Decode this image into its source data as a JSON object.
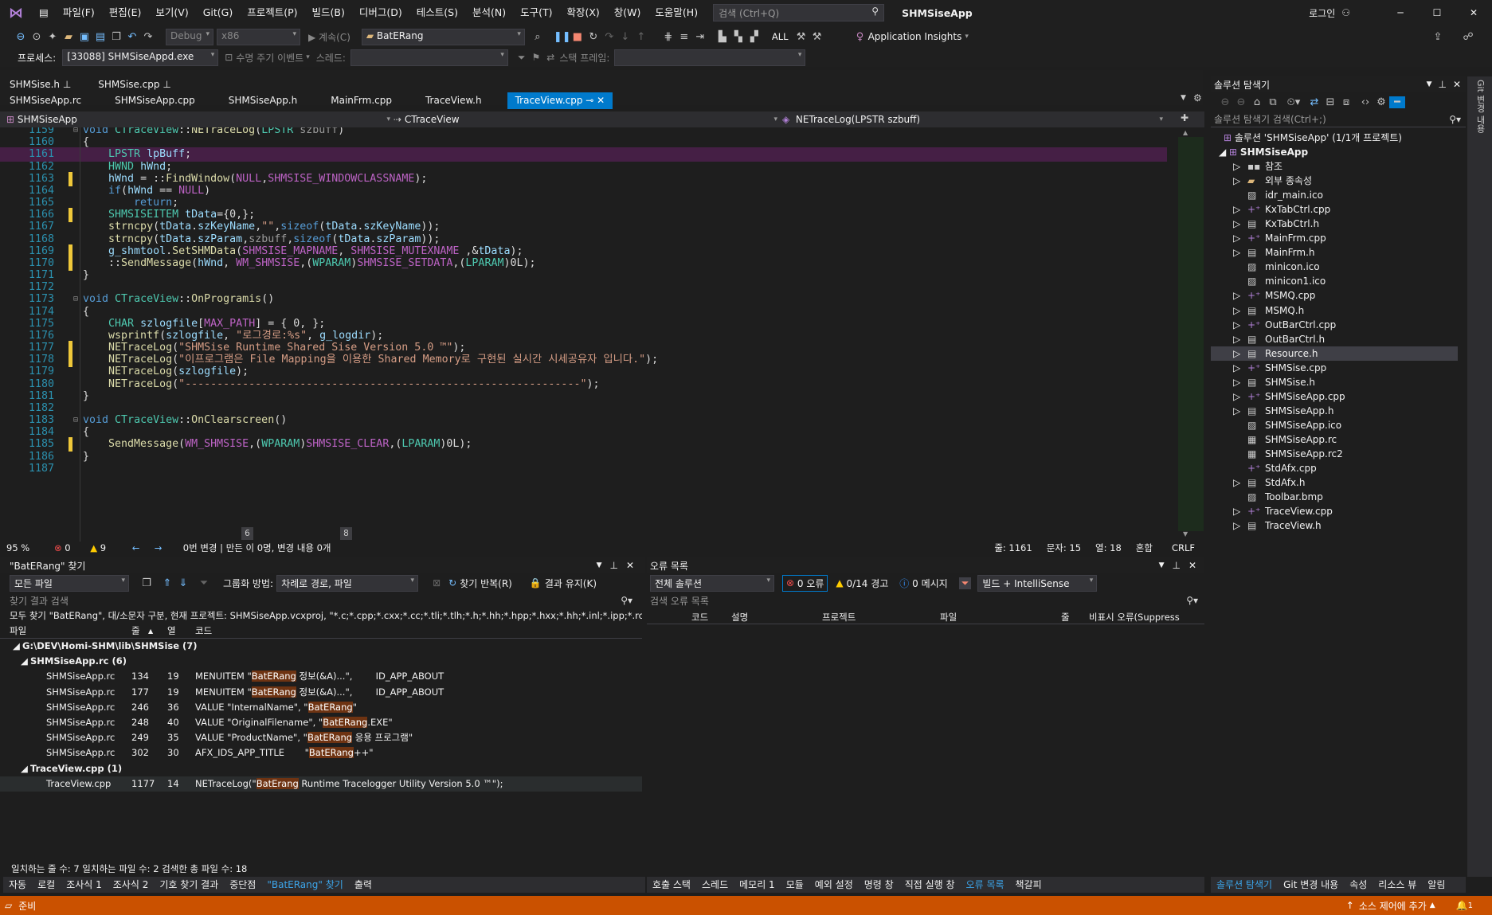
{
  "title_bar": {
    "menu": [
      "파일(F)",
      "편집(E)",
      "보기(V)",
      "Git(G)",
      "프로젝트(P)",
      "빌드(B)",
      "디버그(D)",
      "테스트(S)",
      "분석(N)",
      "도구(T)",
      "확장(X)",
      "창(W)",
      "도움말(H)"
    ],
    "search_placeholder": "검색 (Ctrl+Q)",
    "solution_name": "SHMSiseApp",
    "login": "로그인"
  },
  "toolbar": {
    "config": "Debug",
    "platform": "x86",
    "continue": "계속(C)",
    "find_combo": "BatERang",
    "all_label": "ALL",
    "app_insights": "Application Insights",
    "process_label": "프로세스:",
    "process_value": "[33088] SHMSiseAppd.exe",
    "lifecycle_label": "수명 주기 이벤트",
    "thread_label": "스레드:",
    "stackframe_label": "스택 프레임:"
  },
  "pinned_tabs": [
    "SHMSise.h",
    "SHMSise.cpp"
  ],
  "doc_tabs": [
    "SHMSiseApp.rc",
    "SHMSiseApp.cpp",
    "SHMSiseApp.h",
    "MainFrm.cpp",
    "TraceView.h",
    "TraceView.cpp"
  ],
  "navbar": {
    "project": "SHMSiseApp",
    "class": "CTraceView",
    "member": "NETraceLog(LPSTR szbuff)"
  },
  "code_lines": [
    {
      "n": "1159",
      "t": "void CTraceView::NETraceLog(LPSTR szbuff)"
    },
    {
      "n": "1160",
      "t": "{"
    },
    {
      "n": "1161",
      "t": "    LPSTR lpBuff;"
    },
    {
      "n": "1162",
      "t": "    HWND hWnd;"
    },
    {
      "n": "1163",
      "t": "    hWnd = ::FindWindow(NULL,SHMSISE_WINDOWCLASSNAME);"
    },
    {
      "n": "1164",
      "t": "    if(hWnd == NULL)"
    },
    {
      "n": "1165",
      "t": "        return;"
    },
    {
      "n": "1166",
      "t": "    SHMSISEITEM tData={0,};"
    },
    {
      "n": "1167",
      "t": "    strncpy(tData.szKeyName,\"\",sizeof(tData.szKeyName));"
    },
    {
      "n": "1168",
      "t": "    strncpy(tData.szParam,szbuff,sizeof(tData.szParam));"
    },
    {
      "n": "1169",
      "t": "    g_shmtool.SetSHMData(SHMSISE_MAPNAME, SHMSISE_MUTEXNAME ,&tData);"
    },
    {
      "n": "1170",
      "t": "    ::SendMessage(hWnd, WM_SHMSISE,(WPARAM)SHMSISE_SETDATA,(LPARAM)0L);"
    },
    {
      "n": "1171",
      "t": "}"
    },
    {
      "n": "1172",
      "t": ""
    },
    {
      "n": "1173",
      "t": "void CTraceView::OnProgramis()"
    },
    {
      "n": "1174",
      "t": "{"
    },
    {
      "n": "1175",
      "t": "    CHAR szlogfile[MAX_PATH] = { 0, };"
    },
    {
      "n": "1176",
      "t": "    wsprintf(szlogfile, \"로그경로:%s\", g_logdir);"
    },
    {
      "n": "1177",
      "t": "    NETraceLog(\"SHMSise Runtime Shared Sise Version 5.0 ™\");"
    },
    {
      "n": "1178",
      "t": "    NETraceLog(\"이프로그램은 File Mapping을 이용한 Shared Memory로 구현된 실시간 시세공유자 입니다.\");"
    },
    {
      "n": "1179",
      "t": "    NETraceLog(szlogfile);"
    },
    {
      "n": "1180",
      "t": "    NETraceLog(\"--------------------------------------------------------------\");"
    },
    {
      "n": "1181",
      "t": "}"
    },
    {
      "n": "1182",
      "t": ""
    },
    {
      "n": "1183",
      "t": "void CTraceView::OnClearscreen()"
    },
    {
      "n": "1184",
      "t": "{"
    },
    {
      "n": "1185",
      "t": "    SendMessage(WM_SHMSISE,(WPARAM)SHMSISE_CLEAR,(LPARAM)0L);"
    },
    {
      "n": "1186",
      "t": "}"
    },
    {
      "n": "1187",
      "t": ""
    }
  ],
  "codelens": {
    "a": "6",
    "b": "8"
  },
  "editor_status": {
    "zoom": "95 %",
    "errors": "0",
    "warnings": "9",
    "changes": "0번 변경 | 만든 이 0명, 변경 내용 0개",
    "line": "줄: 1161",
    "char": "문자: 15",
    "col": "열: 18",
    "mixed": "혼합",
    "eol": "CRLF"
  },
  "find_panel": {
    "title": "\"BatERang\" 찾기",
    "scope": "모든 파일",
    "group_label": "그룹화 방법:",
    "group_value": "차례로 경로, 파일",
    "repeat": "찾기 반복(R)",
    "keep": "결과 유지(K)",
    "search_placeholder": "찾기 결과 검색",
    "summary": "모두 찾기 \"BatERang\", 대/소문자 구분, 현재 프로젝트: SHMSiseApp.vcxproj, \"*.c;*.cpp;*.cxx;*.cc;*.tli;*.tlh;*.h;*.hh;*.hpp;*.hxx;*.hh;*.inl;*.ipp;*.rc;*.res",
    "cols": [
      "파일",
      "줄",
      "열",
      "코드"
    ],
    "root": "G:\\DEV\\Homi-SHM\\lib\\SHMSise (7)",
    "groups": [
      {
        "name": "SHMSiseApp.rc (6)",
        "rows": [
          {
            "file": "SHMSiseApp.rc",
            "line": "134",
            "col": "19",
            "pre": "MENUITEM \"",
            "hit": "BatERang",
            "post": " 정보(&A)...\",        ID_APP_ABOUT"
          },
          {
            "file": "SHMSiseApp.rc",
            "line": "177",
            "col": "19",
            "pre": "MENUITEM \"",
            "hit": "BatERang",
            "post": " 정보(&A)...\",        ID_APP_ABOUT"
          },
          {
            "file": "SHMSiseApp.rc",
            "line": "246",
            "col": "36",
            "pre": "VALUE \"InternalName\", \"",
            "hit": "BatERang",
            "post": "\""
          },
          {
            "file": "SHMSiseApp.rc",
            "line": "248",
            "col": "40",
            "pre": "VALUE \"OriginalFilename\", \"",
            "hit": "BatERang",
            "post": ".EXE\""
          },
          {
            "file": "SHMSiseApp.rc",
            "line": "249",
            "col": "35",
            "pre": "VALUE \"ProductName\", \"",
            "hit": "BatERang",
            "post": " 응용 프로그램\""
          },
          {
            "file": "SHMSiseApp.rc",
            "line": "302",
            "col": "30",
            "pre": "AFX_IDS_APP_TITLE       \"",
            "hit": "BatERang",
            "post": "++\""
          }
        ]
      },
      {
        "name": "TraceView.cpp (1)",
        "rows": [
          {
            "file": "TraceView.cpp",
            "line": "1177",
            "col": "14",
            "pre": "NETraceLog(\"",
            "hit": "BatErang",
            "post": " Runtime Tracelogger Utility Version 5.0 ™\");"
          }
        ]
      }
    ],
    "footer": "일치하는 줄 수: 7  일치하는 파일 수: 2  검색한 총 파일 수: 18"
  },
  "error_panel": {
    "title": "오류 목록",
    "scope": "전체 솔루션",
    "errors": "0 오류",
    "warnings": "0/14 경고",
    "messages": "0 메시지",
    "build_mode": "빌드 + IntelliSense",
    "search_placeholder": "검색 오류 목록",
    "cols": [
      "코드",
      "설명",
      "프로젝트",
      "파일",
      "줄",
      "비표시 오류(Suppress"
    ]
  },
  "left_bottom_tabs": [
    "자동",
    "로컬",
    "조사식 1",
    "조사식 2",
    "기호 찾기 결과",
    "중단점",
    "\"BatERang\" 찾기",
    "출력"
  ],
  "right_bottom_tabs": [
    "호출 스택",
    "스레드",
    "메모리 1",
    "모듈",
    "예외 설정",
    "명령 창",
    "직접 실행 창",
    "오류 목록",
    "책갈피"
  ],
  "solution_explorer": {
    "title": "솔루션 탐색기",
    "search_placeholder": "솔루션 탐색기 검색(Ctrl+;)",
    "solution": "솔루션 'SHMSiseApp' (1/1개 프로젝트)",
    "project": "SHMSiseApp",
    "items": [
      {
        "label": "참조",
        "exp": true,
        "kind": "ref"
      },
      {
        "label": "외부 종속성",
        "exp": true,
        "kind": "ext"
      },
      {
        "label": "idr_main.ico",
        "exp": false,
        "kind": "img"
      },
      {
        "label": "KxTabCtrl.cpp",
        "exp": true,
        "kind": "cpp"
      },
      {
        "label": "KxTabCtrl.h",
        "exp": true,
        "kind": "h"
      },
      {
        "label": "MainFrm.cpp",
        "exp": true,
        "kind": "cpp"
      },
      {
        "label": "MainFrm.h",
        "exp": true,
        "kind": "h"
      },
      {
        "label": "minicon.ico",
        "exp": false,
        "kind": "img"
      },
      {
        "label": "minicon1.ico",
        "exp": false,
        "kind": "img"
      },
      {
        "label": "MSMQ.cpp",
        "exp": true,
        "kind": "cpp"
      },
      {
        "label": "MSMQ.h",
        "exp": true,
        "kind": "h"
      },
      {
        "label": "OutBarCtrl.cpp",
        "exp": true,
        "kind": "cpp"
      },
      {
        "label": "OutBarCtrl.h",
        "exp": true,
        "kind": "h"
      },
      {
        "label": "Resource.h",
        "exp": true,
        "kind": "h"
      },
      {
        "label": "SHMSise.cpp",
        "exp": true,
        "kind": "cpp"
      },
      {
        "label": "SHMSise.h",
        "exp": true,
        "kind": "h"
      },
      {
        "label": "SHMSiseApp.cpp",
        "exp": true,
        "kind": "cpp"
      },
      {
        "label": "SHMSiseApp.h",
        "exp": true,
        "kind": "h"
      },
      {
        "label": "SHMSiseApp.ico",
        "exp": false,
        "kind": "img"
      },
      {
        "label": "SHMSiseApp.rc",
        "exp": false,
        "kind": "rc"
      },
      {
        "label": "SHMSiseApp.rc2",
        "exp": false,
        "kind": "rc"
      },
      {
        "label": "StdAfx.cpp",
        "exp": false,
        "kind": "cpp"
      },
      {
        "label": "StdAfx.h",
        "exp": true,
        "kind": "h"
      },
      {
        "label": "Toolbar.bmp",
        "exp": false,
        "kind": "img"
      },
      {
        "label": "TraceView.cpp",
        "exp": true,
        "kind": "cpp"
      },
      {
        "label": "TraceView.h",
        "exp": true,
        "kind": "h"
      }
    ],
    "selected": 13,
    "bottom_tabs": [
      "솔루션 탐색기",
      "Git 변경 내용",
      "속성",
      "리소스 뷰",
      "알림"
    ]
  },
  "right_strip": "Git 변경 내용",
  "statusbar": {
    "ready": "준비",
    "source_control": "소스 제어에 추가",
    "notif": "1"
  },
  "colors": {
    "accent": "#007acc",
    "status": "#ca5100",
    "highlight_line": "#451f45",
    "find_hit": "#6e3312"
  }
}
